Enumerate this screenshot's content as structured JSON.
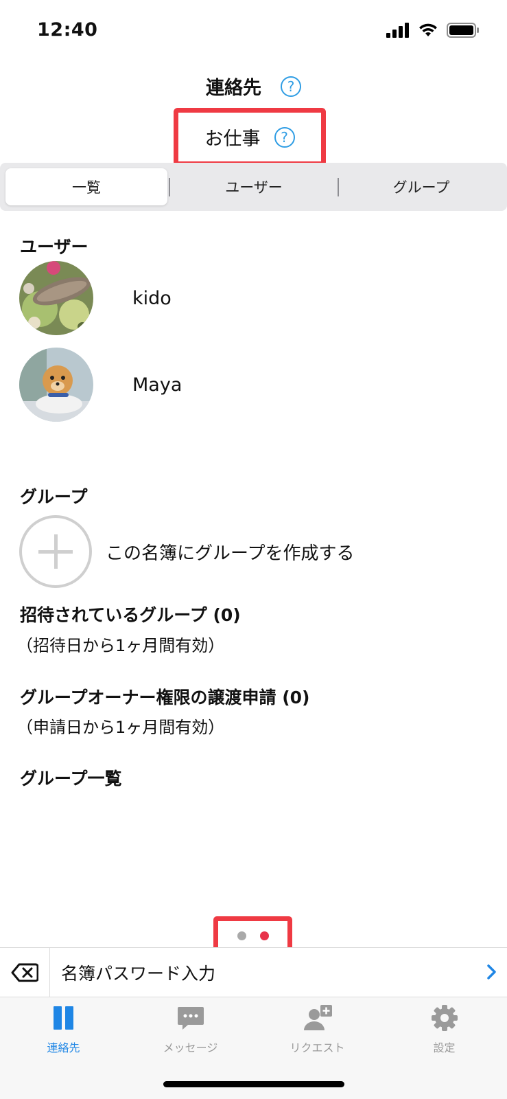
{
  "status": {
    "time": "12:40"
  },
  "header": {
    "title": "連絡先",
    "book_name": "お仕事",
    "help_glyph": "?"
  },
  "segments": {
    "list": "一覧",
    "users": "ユーザー",
    "groups": "グループ"
  },
  "users_section": {
    "title": "ユーザー",
    "users": [
      {
        "name": "kido"
      },
      {
        "name": "Maya"
      }
    ]
  },
  "groups_section": {
    "title": "グループ",
    "create_label": "この名簿にグループを作成する",
    "invited_title": "招待されているグループ (0)",
    "invited_note": "（招待日から1ヶ月間有効）",
    "transfer_title": "グループオーナー権限の譲渡申請 (0)",
    "transfer_note": "（申請日から1ヶ月間有効）",
    "group_list_title": "グループ一覧"
  },
  "pager": {
    "page_count": 2,
    "current_page": 2,
    "active_color": "#e8334a",
    "inactive_color": "#a9a9a9"
  },
  "password_bar": {
    "label": "名簿パスワード入力"
  },
  "tabs": [
    {
      "label": "連絡先",
      "icon": "contacts-icon",
      "active": true
    },
    {
      "label": "メッセージ",
      "icon": "message-icon",
      "active": false
    },
    {
      "label": "リクエスト",
      "icon": "request-icon",
      "active": false
    },
    {
      "label": "設定",
      "icon": "gear-icon",
      "active": false
    }
  ],
  "colors": {
    "accent": "#1f86e5",
    "highlight": "#ef3a43",
    "help": "#2f9de4"
  }
}
